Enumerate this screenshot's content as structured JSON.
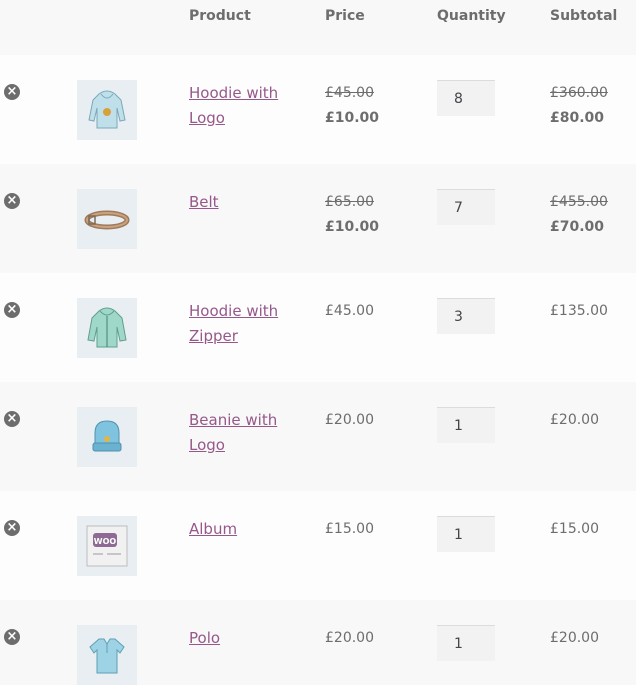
{
  "header": {
    "product": "Product",
    "price": "Price",
    "quantity": "Quantity",
    "subtotal": "Subtotal"
  },
  "items": [
    {
      "name_line1": "Hoodie with",
      "name_line2": "Logo",
      "price_regular": "£45.00",
      "price_sale": "£10.00",
      "quantity": "8",
      "subtotal_regular": "£360.00",
      "subtotal_sale": "£80.00",
      "thumb_icon": "hoodie-logo-icon"
    },
    {
      "name_line1": "Belt",
      "name_line2": "",
      "price_regular": "£65.00",
      "price_sale": "£10.00",
      "quantity": "7",
      "subtotal_regular": "£455.00",
      "subtotal_sale": "£70.00",
      "thumb_icon": "belt-icon"
    },
    {
      "name_line1": "Hoodie with",
      "name_line2": "Zipper",
      "price": "£45.00",
      "quantity": "3",
      "subtotal": "£135.00",
      "thumb_icon": "hoodie-zipper-icon"
    },
    {
      "name_line1": "Beanie with",
      "name_line2": "Logo",
      "price": "£20.00",
      "quantity": "1",
      "subtotal": "£20.00",
      "thumb_icon": "beanie-icon"
    },
    {
      "name_line1": "Album",
      "name_line2": "",
      "price": "£15.00",
      "quantity": "1",
      "subtotal": "£15.00",
      "thumb_icon": "album-icon",
      "album_text": "WOO"
    },
    {
      "name_line1": "Polo",
      "name_line2": "",
      "price": "£20.00",
      "quantity": "1",
      "subtotal": "£20.00",
      "thumb_icon": "polo-icon"
    }
  ],
  "icons": {
    "remove": "remove-item-icon",
    "remove_glyph": "×"
  },
  "colors": {
    "link": "#96588a",
    "text": "#6d6d6d",
    "row_alt": "#f8f8f8"
  }
}
